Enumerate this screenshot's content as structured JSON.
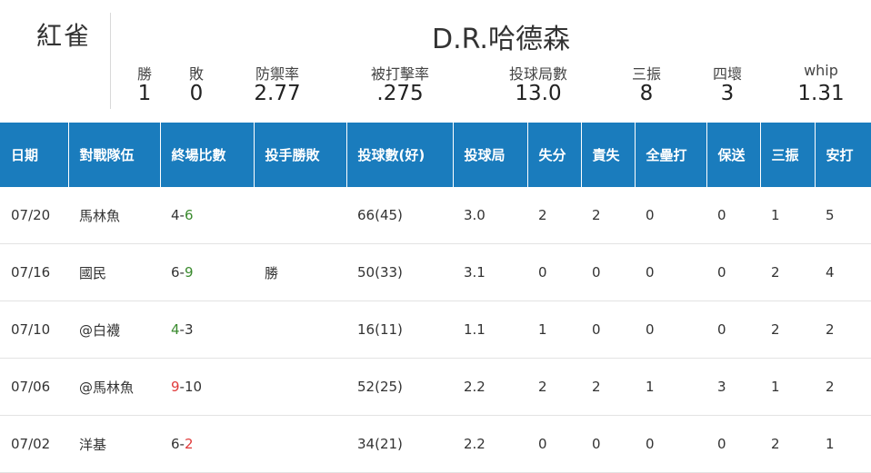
{
  "team": "紅雀",
  "player": "D.R.哈德森",
  "summary": [
    {
      "label": "勝",
      "value": "1"
    },
    {
      "label": "敗",
      "value": "0"
    },
    {
      "label": "防禦率",
      "value": "2.77"
    },
    {
      "label": "被打擊率",
      "value": ".275"
    },
    {
      "label": "投球局數",
      "value": "13.0"
    },
    {
      "label": "三振",
      "value": "8"
    },
    {
      "label": "四壞",
      "value": "3"
    },
    {
      "label": "whip",
      "value": "1.31"
    }
  ],
  "table": {
    "headers": [
      "日期",
      "對戰隊伍",
      "終場比數",
      "投手勝敗",
      "投球數(好)",
      "投球局",
      "失分",
      "責失",
      "全壘打",
      "保送",
      "三振",
      "安打"
    ],
    "rows": [
      {
        "date": "07/20",
        "opponent": "馬林魚",
        "score_a": "4",
        "score_b": "6",
        "a_color": "normal",
        "b_color": "green",
        "decision": "",
        "pitches": "66(45)",
        "ip": "3.0",
        "r": "2",
        "er": "2",
        "hr": "0",
        "bb": "0",
        "so": "1",
        "h": "5"
      },
      {
        "date": "07/16",
        "opponent": "國民",
        "score_a": "6",
        "score_b": "9",
        "a_color": "normal",
        "b_color": "green",
        "decision": "勝",
        "pitches": "50(33)",
        "ip": "3.1",
        "r": "0",
        "er": "0",
        "hr": "0",
        "bb": "0",
        "so": "2",
        "h": "4"
      },
      {
        "date": "07/10",
        "opponent": "@白襪",
        "score_a": "4",
        "score_b": "3",
        "a_color": "green",
        "b_color": "normal",
        "decision": "",
        "pitches": "16(11)",
        "ip": "1.1",
        "r": "1",
        "er": "0",
        "hr": "0",
        "bb": "0",
        "so": "2",
        "h": "2"
      },
      {
        "date": "07/06",
        "opponent": "@馬林魚",
        "score_a": "9",
        "score_b": "10",
        "a_color": "red",
        "b_color": "normal",
        "decision": "",
        "pitches": "52(25)",
        "ip": "2.2",
        "r": "2",
        "er": "2",
        "hr": "1",
        "bb": "3",
        "so": "1",
        "h": "2"
      },
      {
        "date": "07/02",
        "opponent": "洋基",
        "score_a": "6",
        "score_b": "2",
        "a_color": "normal",
        "b_color": "red",
        "decision": "",
        "pitches": "34(21)",
        "ip": "2.2",
        "r": "0",
        "er": "0",
        "hr": "0",
        "bb": "0",
        "so": "2",
        "h": "1"
      }
    ]
  },
  "colors": {
    "header_bg": "#1a7cbd",
    "win_green": "#3a8a2e",
    "loss_red": "#e03b3b"
  }
}
